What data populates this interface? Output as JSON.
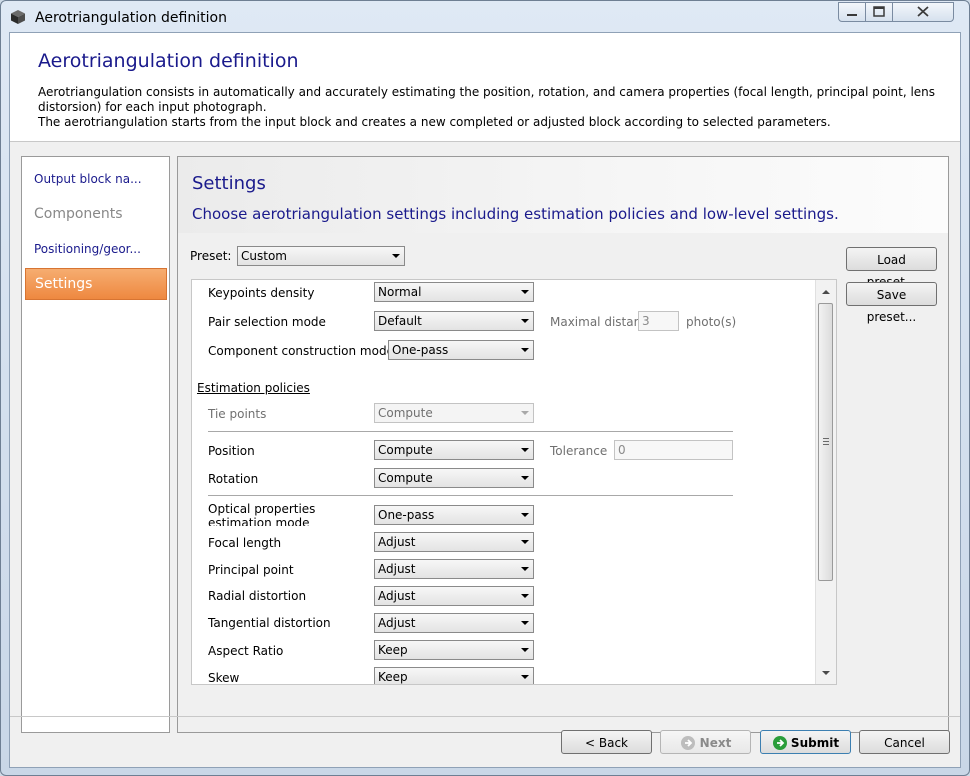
{
  "window": {
    "title": "Aerotriangulation definition",
    "controls": {
      "minimize": "—",
      "maximize": "☐",
      "close": "✕"
    }
  },
  "header": {
    "title": "Aerotriangulation definition",
    "description_line1": "Aerotriangulation consists in automatically and accurately estimating the position, rotation, and camera properties (focal length, principal point, lens distorsion) for each input photograph.",
    "description_line2": "The aerotriangulation starts from the input block and creates a new completed or adjusted block according to selected parameters."
  },
  "sidebar": {
    "items": [
      {
        "label": "Output block na...",
        "state": "link"
      },
      {
        "label": "Components",
        "state": "disabled"
      },
      {
        "label": "Positioning/geor...",
        "state": "link"
      },
      {
        "label": "Settings",
        "state": "selected"
      }
    ]
  },
  "settings": {
    "title": "Settings",
    "subtitle": "Choose aerotriangulation settings including estimation policies and low-level settings.",
    "preset_label": "Preset:",
    "preset_value": "Custom",
    "load_preset": "Load preset...",
    "save_preset": "Save preset...",
    "keypoints_density": {
      "label": "Keypoints density",
      "value": "Normal"
    },
    "pair_selection_mode": {
      "label": "Pair selection mode",
      "value": "Default"
    },
    "maximal_distance": {
      "label": "Maximal distar",
      "value": "3",
      "unit": "photo(s)"
    },
    "component_construction_mode": {
      "label": "Component construction mode",
      "value": "One-pass"
    },
    "estimation_policies_heading": "Estimation policies",
    "tie_points": {
      "label": "Tie points",
      "value": "Compute"
    },
    "position": {
      "label": "Position",
      "value": "Compute"
    },
    "tolerance": {
      "label": "Tolerance",
      "value": "0"
    },
    "rotation": {
      "label": "Rotation",
      "value": "Compute"
    },
    "optical_properties": {
      "label_line1": "Optical properties",
      "label_line2": "estimation mode",
      "value": "One-pass"
    },
    "focal_length": {
      "label": "Focal length",
      "value": "Adjust"
    },
    "principal_point": {
      "label": "Principal point",
      "value": "Adjust"
    },
    "radial_distortion": {
      "label": "Radial distortion",
      "value": "Adjust"
    },
    "tangential_distortion": {
      "label": "Tangential distortion",
      "value": "Adjust"
    },
    "aspect_ratio": {
      "label": "Aspect Ratio",
      "value": "Keep"
    },
    "skew": {
      "label": "Skew",
      "value": "Keep"
    }
  },
  "footer": {
    "back": "< Back",
    "next": "Next",
    "submit": "Submit",
    "cancel": "Cancel"
  },
  "colors": {
    "heading_blue": "#1a1a8c",
    "selected_orange": "#ee8840",
    "submit_icon_green": "#2a9d3a"
  }
}
